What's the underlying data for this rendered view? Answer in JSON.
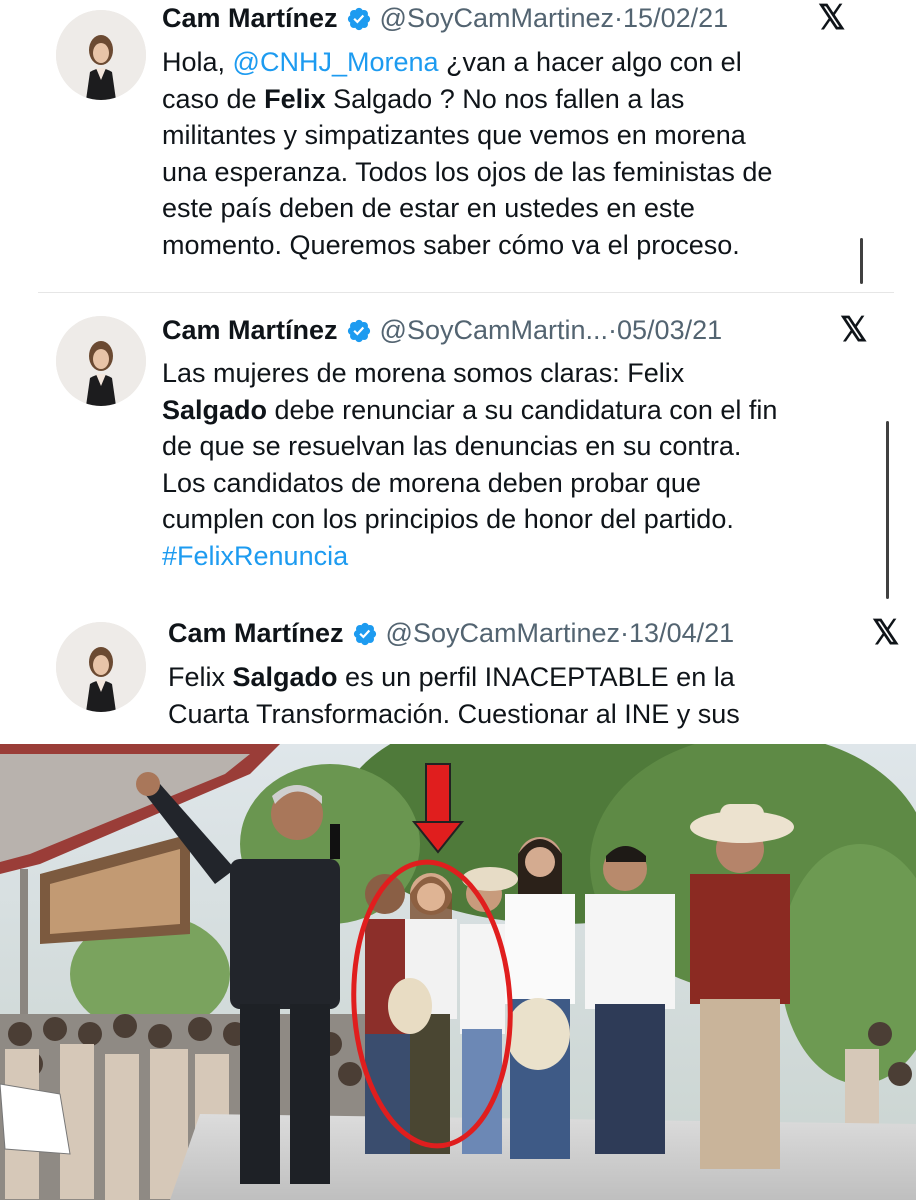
{
  "tweets": [
    {
      "name": "Cam Martínez",
      "handle": "@SoyCamMartinez",
      "date": "15/02/21",
      "lines": [
        [
          {
            "t": "Hola, "
          },
          {
            "t": "@CNHJ_Morena",
            "k": "mention"
          },
          {
            "t": " ¿van a hacer algo con el"
          }
        ],
        [
          {
            "t": "caso de "
          },
          {
            "t": "Felix",
            "k": "bold"
          },
          {
            "t": " Salgado ? No nos fallen a las"
          }
        ],
        [
          {
            "t": "militantes y simpatizantes que vemos en morena"
          }
        ],
        [
          {
            "t": "una esperanza. Todos los ojos de las feministas de"
          }
        ],
        [
          {
            "t": "este país deben de estar en ustedes en este"
          }
        ],
        [
          {
            "t": "momento. Queremos saber cómo va el proceso."
          }
        ]
      ]
    },
    {
      "name": "Cam Martínez",
      "handle": "@SoyCamMartin...",
      "date": "05/03/21",
      "lines": [
        [
          {
            "t": "Las mujeres de morena somos claras: Felix"
          }
        ],
        [
          {
            "t": "Salgado",
            "k": "bold"
          },
          {
            "t": " debe renunciar a su candidatura con el fin"
          }
        ],
        [
          {
            "t": "de que se resuelvan las denuncias en su contra."
          }
        ],
        [
          {
            "t": "Los candidatos de morena deben probar que"
          }
        ],
        [
          {
            "t": "cumplen con los principios de honor del partido."
          }
        ],
        [
          {
            "t": "#FelixRenuncia",
            "k": "hashtag"
          }
        ]
      ]
    },
    {
      "name": "Cam Martínez",
      "handle": "@SoyCamMartinez",
      "date": "13/04/21",
      "lines": [
        [
          {
            "t": "Felix "
          },
          {
            "t": "Salgado",
            "k": "bold"
          },
          {
            "t": " es un perfil INACEPTABLE en la"
          }
        ],
        [
          {
            "t": "Cuarta Transformación. Cuestionar al INE y sus"
          }
        ]
      ]
    }
  ],
  "date_separator": " · ",
  "x_logo": "𝕏",
  "icons": {
    "verified": "verified-badge-icon",
    "x": "x-logo-icon",
    "arrow": "red-arrow-icon"
  },
  "colors": {
    "link": "#1d9bf0",
    "handle": "#536471",
    "annotation": "#e01e1e"
  }
}
